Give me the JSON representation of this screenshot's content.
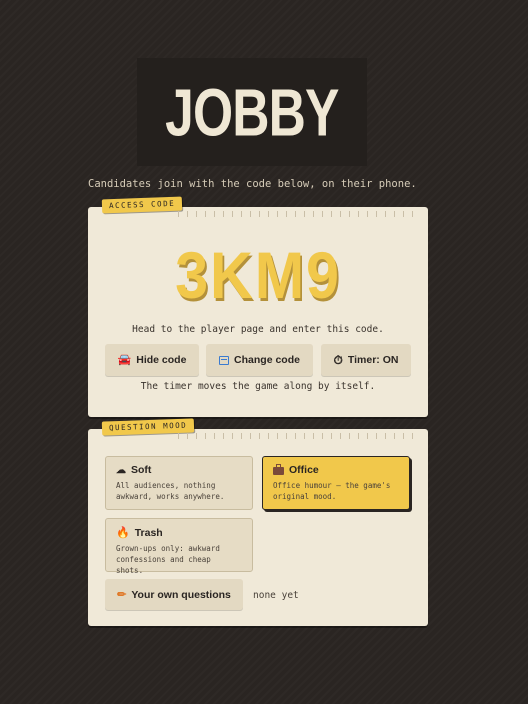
{
  "app": {
    "logo": "JOBBY",
    "subtitle": "Candidates join with the code below, on their phone."
  },
  "access": {
    "tag": "ACCESS CODE",
    "code": "3KM9",
    "hint": "Head to the player page and enter this code.",
    "buttons": {
      "hide": "Hide code",
      "change": "Change code",
      "timer": "Timer: ON"
    },
    "note": "The timer moves the game along by itself."
  },
  "mood": {
    "tag": "QUESTION MOOD",
    "options": [
      {
        "label": "Soft",
        "desc": "All audiences, nothing awkward, works anywhere.",
        "selected": false,
        "icon": "cloud-icon"
      },
      {
        "label": "Office",
        "desc": "Office humour — the game's original mood.",
        "selected": true,
        "icon": "briefcase-icon"
      },
      {
        "label": "Trash",
        "desc": "Grown-ups only: awkward confessions and cheap shots.",
        "selected": false,
        "icon": "fire-icon"
      }
    ],
    "own_questions": "Your own questions",
    "own_status": "none yet"
  },
  "colors": {
    "background": "#2a2522",
    "card": "#f0e9d8",
    "accent": "#f1c84b"
  }
}
